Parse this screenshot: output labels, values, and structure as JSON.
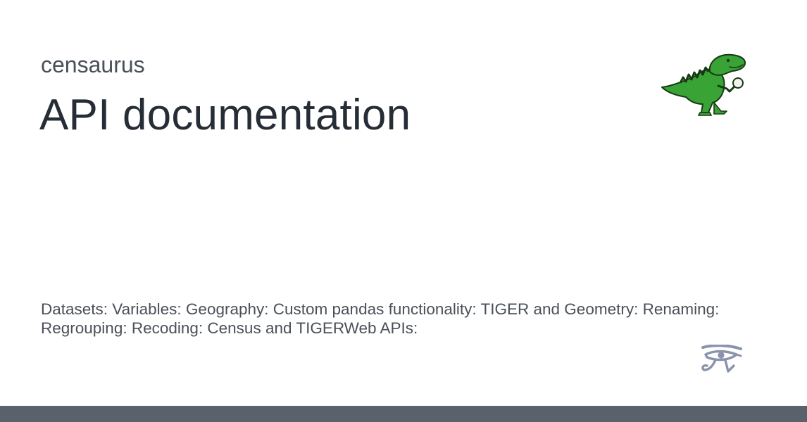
{
  "site": {
    "name": "censaurus"
  },
  "page": {
    "title": "API documentation",
    "description": "Datasets: Variables: Geography: Custom pandas functionality: TIGER and Geometry: Renaming: Regrouping: Recoding: Census and TIGERWeb APIs:"
  },
  "logo": {
    "icon": "dinosaur-with-magnifying-glass-icon",
    "color": "#3aa335"
  },
  "badge": {
    "icon": "eye-of-horus-icon",
    "color": "#8a93ad"
  },
  "footer": {
    "color": "#5b616b"
  }
}
